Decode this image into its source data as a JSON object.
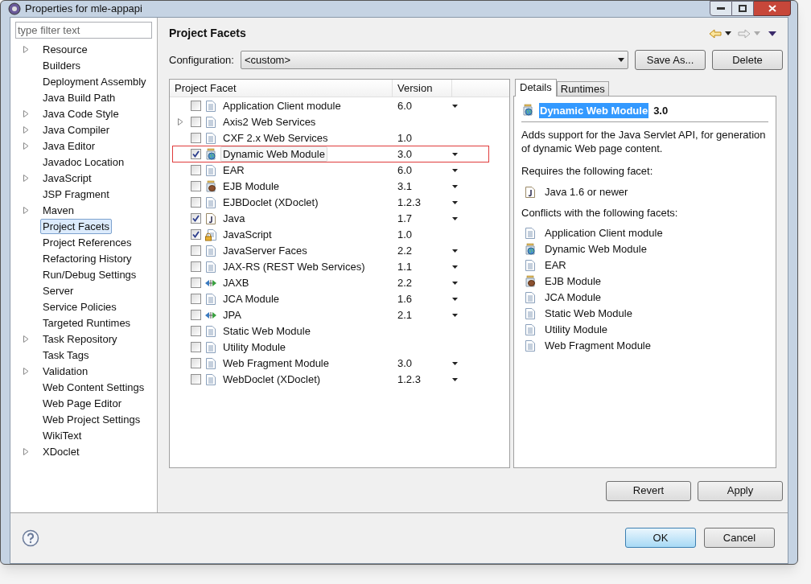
{
  "window": {
    "title": "Properties for mle-appapi"
  },
  "filter": {
    "placeholder": "type filter text"
  },
  "sidebar": {
    "items": [
      {
        "label": "Resource",
        "expandable": true,
        "selected": false
      },
      {
        "label": "Builders",
        "expandable": false,
        "selected": false
      },
      {
        "label": "Deployment Assembly",
        "expandable": false,
        "selected": false
      },
      {
        "label": "Java Build Path",
        "expandable": false,
        "selected": false
      },
      {
        "label": "Java Code Style",
        "expandable": true,
        "selected": false
      },
      {
        "label": "Java Compiler",
        "expandable": true,
        "selected": false
      },
      {
        "label": "Java Editor",
        "expandable": true,
        "selected": false
      },
      {
        "label": "Javadoc Location",
        "expandable": false,
        "selected": false
      },
      {
        "label": "JavaScript",
        "expandable": true,
        "selected": false
      },
      {
        "label": "JSP Fragment",
        "expandable": false,
        "selected": false
      },
      {
        "label": "Maven",
        "expandable": true,
        "selected": false
      },
      {
        "label": "Project Facets",
        "expandable": false,
        "selected": true
      },
      {
        "label": "Project References",
        "expandable": false,
        "selected": false
      },
      {
        "label": "Refactoring History",
        "expandable": false,
        "selected": false
      },
      {
        "label": "Run/Debug Settings",
        "expandable": false,
        "selected": false
      },
      {
        "label": "Server",
        "expandable": false,
        "selected": false
      },
      {
        "label": "Service Policies",
        "expandable": false,
        "selected": false
      },
      {
        "label": "Targeted Runtimes",
        "expandable": false,
        "selected": false
      },
      {
        "label": "Task Repository",
        "expandable": true,
        "selected": false
      },
      {
        "label": "Task Tags",
        "expandable": false,
        "selected": false
      },
      {
        "label": "Validation",
        "expandable": true,
        "selected": false
      },
      {
        "label": "Web Content Settings",
        "expandable": false,
        "selected": false
      },
      {
        "label": "Web Page Editor",
        "expandable": false,
        "selected": false
      },
      {
        "label": "Web Project Settings",
        "expandable": false,
        "selected": false
      },
      {
        "label": "WikiText",
        "expandable": false,
        "selected": false
      },
      {
        "label": "XDoclet",
        "expandable": true,
        "selected": false
      }
    ]
  },
  "page": {
    "title": "Project Facets",
    "configuration": {
      "label": "Configuration:",
      "value": "<custom>"
    },
    "buttons": [
      "Save As...",
      "Delete"
    ],
    "table": {
      "columns": [
        "Project Facet",
        "Version"
      ],
      "rows": [
        {
          "kind": "page",
          "label": "Application Client module",
          "version": "6.0",
          "dropdown": true,
          "checked": false,
          "expandable": false,
          "selected": false
        },
        {
          "kind": "page",
          "label": "Axis2 Web Services",
          "dropdown": false,
          "checked": false,
          "expandable": true,
          "selected": false
        },
        {
          "kind": "page",
          "label": "CXF 2.x Web Services",
          "version": "1.0",
          "dropdown": false,
          "checked": false,
          "expandable": false,
          "selected": false
        },
        {
          "kind": "globe",
          "label": "Dynamic Web Module",
          "version": "3.0",
          "dropdown": true,
          "checked": true,
          "expandable": false,
          "selected": true
        },
        {
          "kind": "page",
          "label": "EAR",
          "version": "6.0",
          "dropdown": true,
          "checked": false,
          "expandable": false,
          "selected": false
        },
        {
          "kind": "bean",
          "label": "EJB Module",
          "version": "3.1",
          "dropdown": true,
          "checked": false,
          "expandable": false,
          "selected": false
        },
        {
          "kind": "page",
          "label": "EJBDoclet (XDoclet)",
          "version": "1.2.3",
          "dropdown": true,
          "checked": false,
          "expandable": false,
          "selected": false
        },
        {
          "kind": "java",
          "label": "Java",
          "version": "1.7",
          "dropdown": true,
          "checked": true,
          "expandable": false,
          "selected": false
        },
        {
          "kind": "lock",
          "label": "JavaScript",
          "version": "1.0",
          "dropdown": false,
          "checked": true,
          "expandable": false,
          "selected": false
        },
        {
          "kind": "page",
          "label": "JavaServer Faces",
          "version": "2.2",
          "dropdown": true,
          "checked": false,
          "expandable": false,
          "selected": false
        },
        {
          "kind": "page",
          "label": "JAX-RS (REST Web Services)",
          "version": "1.1",
          "dropdown": true,
          "checked": false,
          "expandable": false,
          "selected": false
        },
        {
          "kind": "arrows",
          "label": "JAXB",
          "version": "2.2",
          "dropdown": true,
          "checked": false,
          "expandable": false,
          "selected": false
        },
        {
          "kind": "page",
          "label": "JCA Module",
          "version": "1.6",
          "dropdown": true,
          "checked": false,
          "expandable": false,
          "selected": false
        },
        {
          "kind": "arrows",
          "label": "JPA",
          "version": "2.1",
          "dropdown": true,
          "checked": false,
          "expandable": false,
          "selected": false
        },
        {
          "kind": "page",
          "label": "Static Web Module",
          "dropdown": false,
          "checked": false,
          "expandable": false,
          "selected": false
        },
        {
          "kind": "page",
          "label": "Utility Module",
          "dropdown": false,
          "checked": false,
          "expandable": false,
          "selected": false
        },
        {
          "kind": "page",
          "label": "Web Fragment Module",
          "version": "3.0",
          "dropdown": true,
          "checked": false,
          "expandable": false,
          "selected": false
        },
        {
          "kind": "page",
          "label": "WebDoclet (XDoclet)",
          "version": "1.2.3",
          "dropdown": true,
          "checked": false,
          "expandable": false,
          "selected": false
        }
      ]
    },
    "tabs": [
      {
        "label": "Details",
        "selected": true
      },
      {
        "label": "Runtimes",
        "selected": false
      }
    ],
    "details": {
      "kind": "globe",
      "name": "Dynamic Web Module",
      "version": "3.0",
      "description": "Adds support for the Java Servlet API, for generation of dynamic Web page content.",
      "requires_heading": "Requires the following facet:",
      "requires": [
        {
          "kind": "java",
          "label": "Java 1.6 or newer"
        }
      ],
      "conflicts_heading": "Conflicts with the following facets:",
      "conflicts": [
        {
          "kind": "page",
          "label": "Application Client module"
        },
        {
          "kind": "globe",
          "label": "Dynamic Web Module"
        },
        {
          "kind": "page",
          "label": "EAR"
        },
        {
          "kind": "bean",
          "label": "EJB Module"
        },
        {
          "kind": "page",
          "label": "JCA Module"
        },
        {
          "kind": "page",
          "label": "Static Web Module"
        },
        {
          "kind": "page",
          "label": "Utility Module"
        },
        {
          "kind": "page",
          "label": "Web Fragment Module"
        }
      ]
    },
    "page_buttons": [
      "Revert",
      "Apply"
    ]
  },
  "dialog_buttons": [
    {
      "label": "OK",
      "default": true
    },
    {
      "label": "Cancel",
      "default": false
    }
  ]
}
